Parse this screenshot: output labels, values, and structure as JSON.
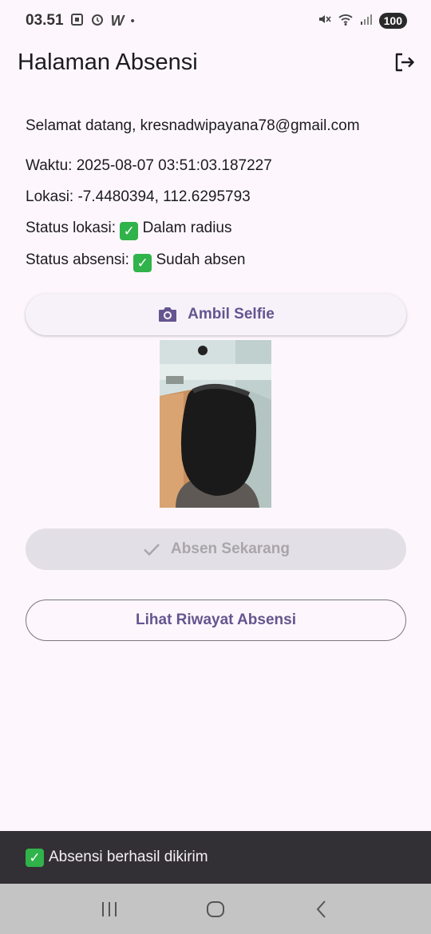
{
  "status_bar": {
    "time": "03.51",
    "battery": "100"
  },
  "appbar": {
    "title": "Halaman Absensi",
    "logout_icon": "logout-icon"
  },
  "info": {
    "welcome": "Selamat datang, kresnadwipayana78@gmail.com",
    "time": "Waktu: 2025-08-07 03:51:03.187227",
    "location": "Lokasi: -7.4480394, 112.6295793",
    "location_status_label": "Status lokasi: ",
    "location_status_value": "Dalam radius",
    "absence_status_label": "Status absensi: ",
    "absence_status_value": "Sudah absen"
  },
  "buttons": {
    "selfie_label": "Ambil Selfie",
    "absen_label": "Absen Sekarang",
    "history_label": "Lihat Riwayat Absensi"
  },
  "snackbar": {
    "message": "Absensi berhasil dikirim"
  },
  "colors": {
    "accent": "#65558f",
    "background": "#fdf7fd",
    "success": "#30b34a"
  }
}
